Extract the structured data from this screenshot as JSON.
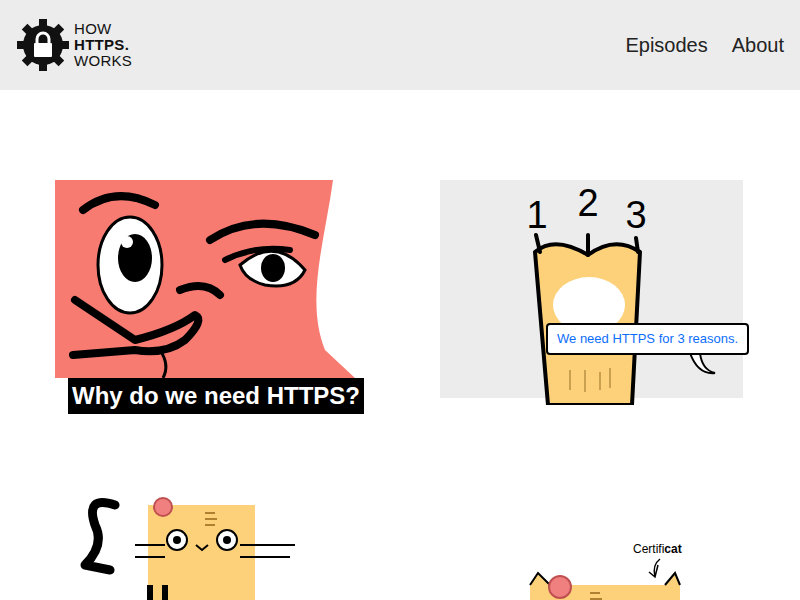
{
  "logo": [
    "HOW",
    "HTTPS.",
    "WORKS"
  ],
  "nav": [
    {
      "label": "Episodes"
    },
    {
      "label": "About"
    }
  ],
  "episodes": [
    {
      "kind": "face",
      "caption": "Why do we need HTTPS?"
    },
    {
      "kind": "paw",
      "numbers": [
        "1",
        "2",
        "3"
      ],
      "bubble": "We need HTTPS for 3 reasons."
    },
    {
      "kind": "cat"
    },
    {
      "kind": "cert",
      "label": [
        "Certifi",
        "cat"
      ]
    }
  ]
}
